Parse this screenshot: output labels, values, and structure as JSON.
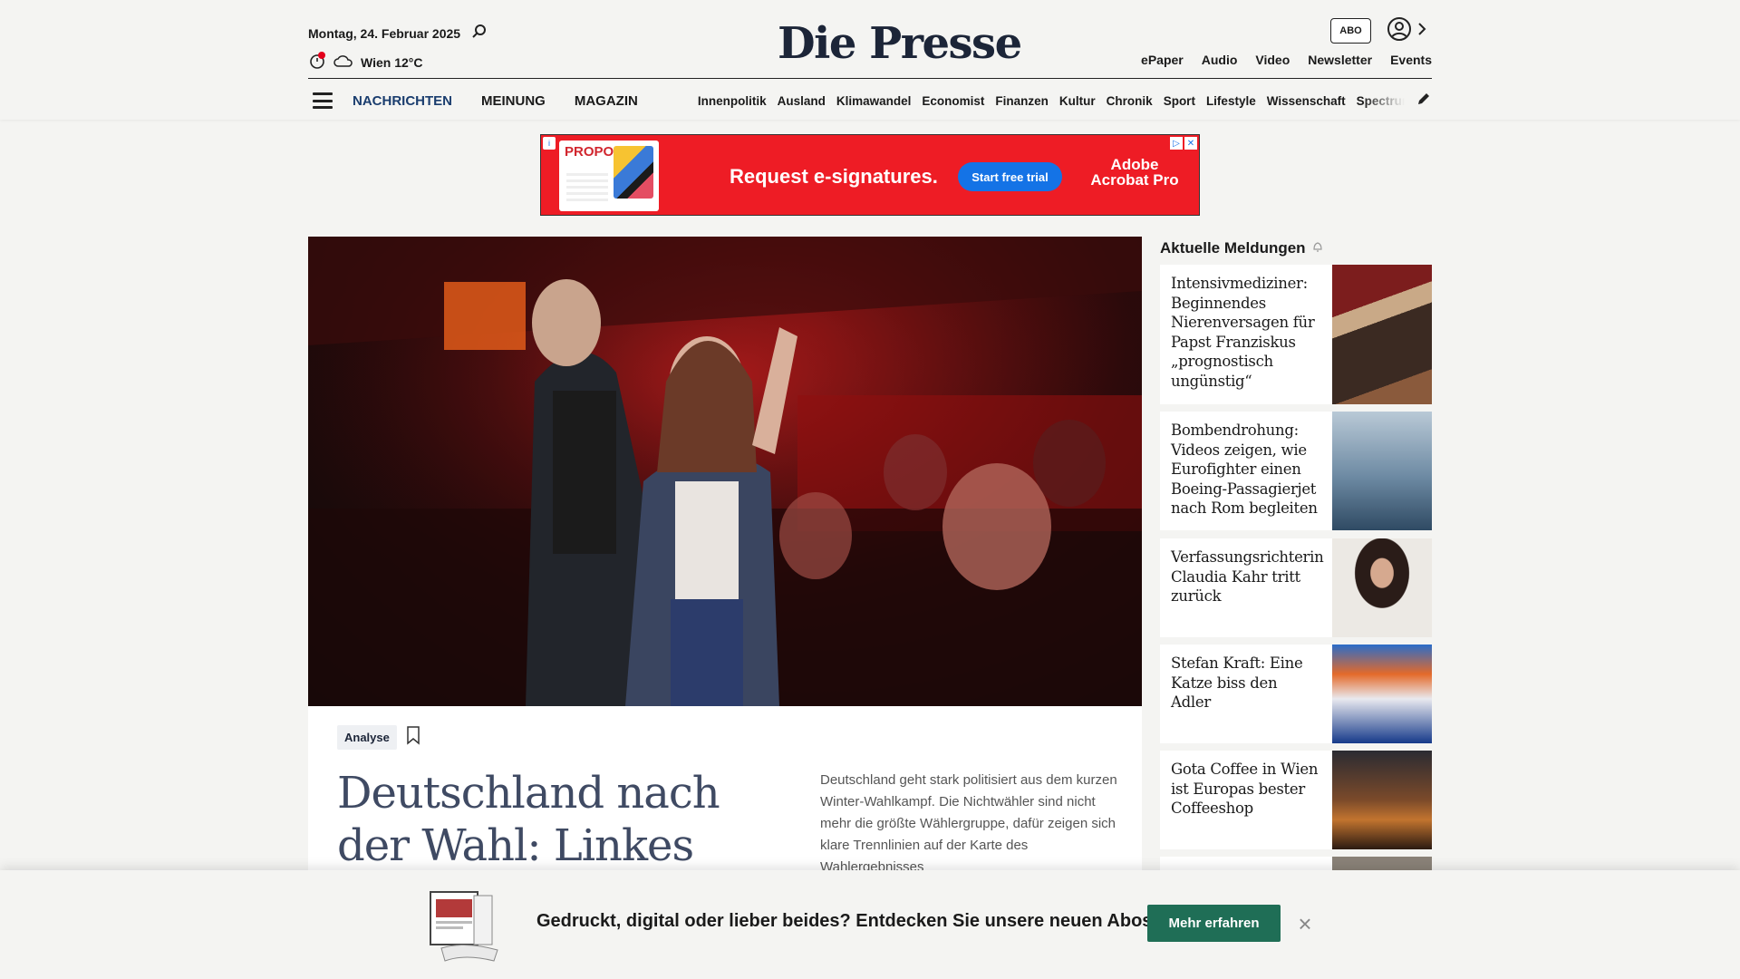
{
  "header": {
    "date": "Montag, 24. Februar 2025",
    "weather": "Wien 12°C",
    "logo": "Die Presse",
    "abo_label": "ABO",
    "top_links": [
      "ePaper",
      "Audio",
      "Video",
      "Newsletter",
      "Events"
    ]
  },
  "nav": {
    "main": [
      "NACHRICHTEN",
      "MEINUNG",
      "MAGAZIN"
    ],
    "sections": [
      "Innenpolitik",
      "Ausland",
      "Klimawandel",
      "Economist",
      "Finanzen",
      "Kultur",
      "Chronik",
      "Sport",
      "Lifestyle",
      "Wissenschaft",
      "Spectrum"
    ]
  },
  "ad": {
    "doc_title": "PROPOSAL",
    "headline": "Request e-signatures.",
    "cta": "Start free trial",
    "brand_line1": "Adobe",
    "brand_line2": "Acrobat Pro"
  },
  "article": {
    "badge": "Analyse",
    "headline": "Deutschland nach der Wahl: Linkes",
    "teaser": "Deutschland geht stark politisiert aus dem kurzen Winter-Wahlkampf. Die Nichtwähler sind nicht mehr die größte Wählergruppe, dafür zeigen sich klare Trennlinien auf der Karte des Wahlergebnisses"
  },
  "sidebar": {
    "title": "Aktuelle Meldungen",
    "items": [
      {
        "text": "Intensivmediziner: Beginnendes Nierenversagen für Papst Franziskus „prognostisch ungünstig“"
      },
      {
        "text": "Bombendrohung: Videos zeigen, wie Eurofighter einen Boeing-Passagierjet nach Rom begleiten"
      },
      {
        "text": "Verfassungsrichterin Claudia Kahr tritt zurück"
      },
      {
        "text": "Stefan Kraft: Eine Katze biss den Adler"
      },
      {
        "text": "Gota Coffee in Wien ist Europas bester Coffeeshop"
      }
    ]
  },
  "promo": {
    "text": "Gedruckt, digital oder lieber beides? Entdecken Sie unsere neuen Abos!",
    "button": "Mehr erfahren",
    "close": "×"
  }
}
